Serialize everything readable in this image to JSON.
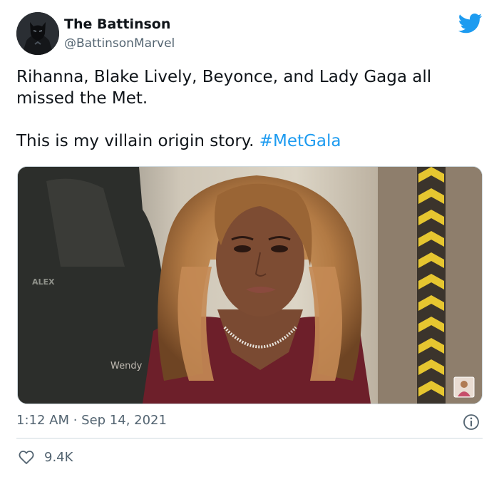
{
  "author": {
    "display_name": "The Battinson",
    "handle": "@BattinsonMarvel",
    "avatar_icon": "batman-avatar",
    "platform_icon": "twitter-bird-icon"
  },
  "tweet": {
    "line1": "Rihanna, Blake Lively, Beyonce, and Lady Gaga all missed the Met.",
    "line2": "This is my villain origin story.",
    "hashtag": "#MetGala",
    "media": {
      "type": "photo",
      "watermark_top": "ALEX",
      "watermark_name": "Wendy"
    },
    "timestamp": "1:12 AM · Sep 14, 2021",
    "likes": "9.4K"
  },
  "colors": {
    "link": "#1d9bf0",
    "secondary_text": "#536471",
    "divider": "#cfd9de"
  }
}
